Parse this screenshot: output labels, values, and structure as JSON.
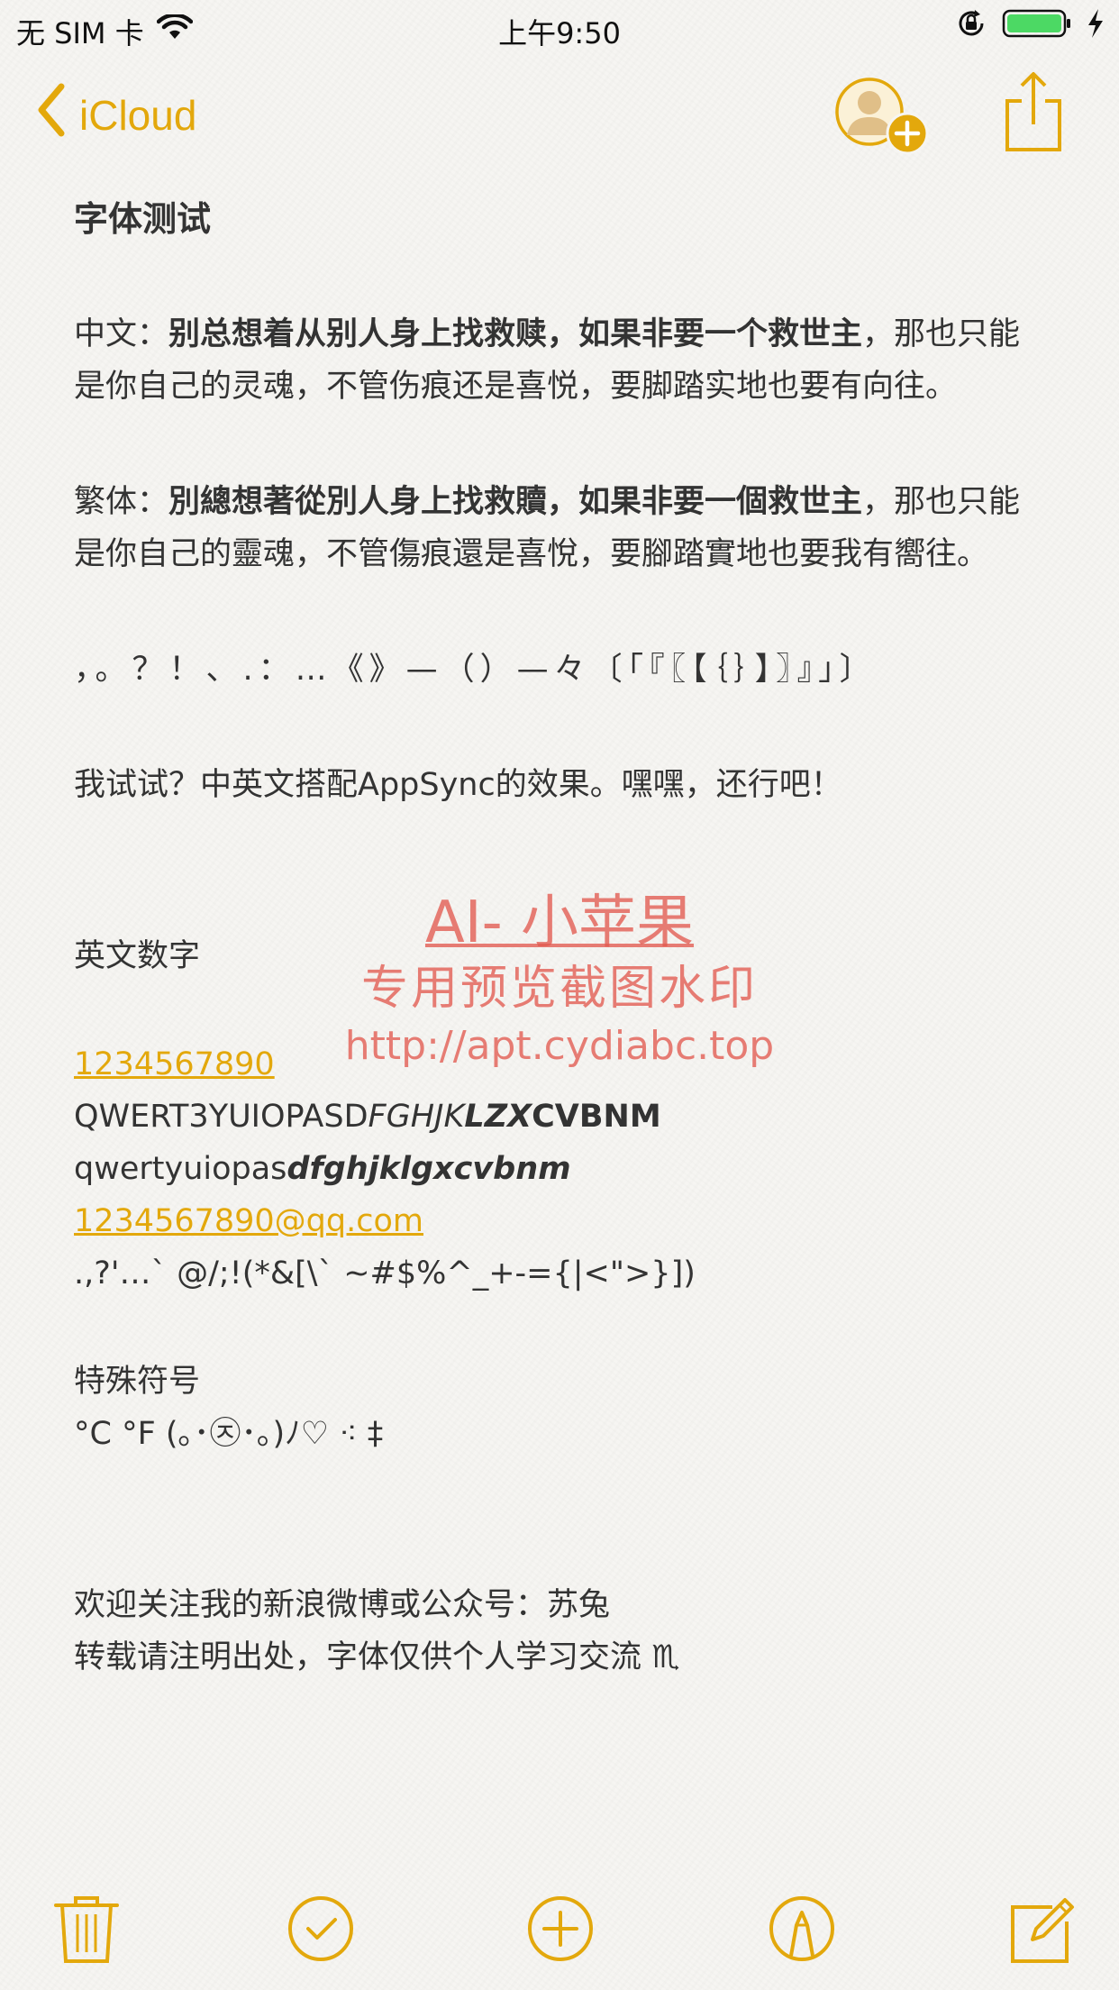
{
  "status_bar": {
    "carrier": "无 SIM 卡",
    "time": "上午9:50",
    "icons": [
      "wifi-icon",
      "orientation-lock-icon",
      "battery-icon",
      "charging-bolt-icon"
    ]
  },
  "nav": {
    "back_label": "iCloud",
    "icons": [
      "chevron-left-icon",
      "add-person-icon",
      "share-icon"
    ]
  },
  "note": {
    "title": "字体测试",
    "p1": {
      "label": "中文：",
      "bold": "别总想着从别人身上找救赎，如果非要一个救世主",
      "rest": "，那也只能是你自己的灵魂，不管伤痕还是喜悦，要脚踏实地也要有向往。"
    },
    "p2": {
      "label": "繁体：",
      "bold": "別總想著從別人身上找救贖，如果非要一個救世主",
      "rest": "，那也只能是你自己的靈魂，不管傷痕還是喜悅，要腳踏實地也要我有嚮往。"
    },
    "punctuation": "，。？！、.：…《》—（）—々〔「『〖【｛｝】〗』」〕",
    "mixed_sentence": "我试试？中英文搭配AppSync的效果。嘿嘿，还行吧！",
    "english_heading": "英文数字",
    "digits_link": "1234567890",
    "upper": {
      "regular": "QWERT3YUIOPASD",
      "italic": "FGHJK",
      "bold_italic": "LZX",
      "bold": "CVBNM"
    },
    "lower": {
      "regular": "qwertyuiopas",
      "bold_italic": "dfghjklgxcvbnm"
    },
    "email_link": "1234567890@qq.com",
    "ascii_symbols": ".,?'…` @/;!(*&[\\` ~#$%^_+-={|<\">}])",
    "special_heading": "特殊符号",
    "special_symbols": "°C °F (｡･㉨･｡)ﾉ♡ ⁖ ‡",
    "follow": "欢迎关注我的新浪微博或公众号：苏兔",
    "reprint": "转载请注明出处，字体仅供个人学习交流 ♏"
  },
  "watermark": {
    "line1": "AI- 小苹果",
    "line2": "专用预览截图水印",
    "line3": "http://apt.cydiabc.top"
  },
  "toolbar": {
    "icons": [
      "trash-icon",
      "checklist-icon",
      "add-icon",
      "markup-pen-icon",
      "compose-icon"
    ]
  },
  "colors": {
    "accent": "#e3a80c",
    "text": "#333333",
    "watermark": "#e25a50",
    "background": "#f6f5f2"
  }
}
